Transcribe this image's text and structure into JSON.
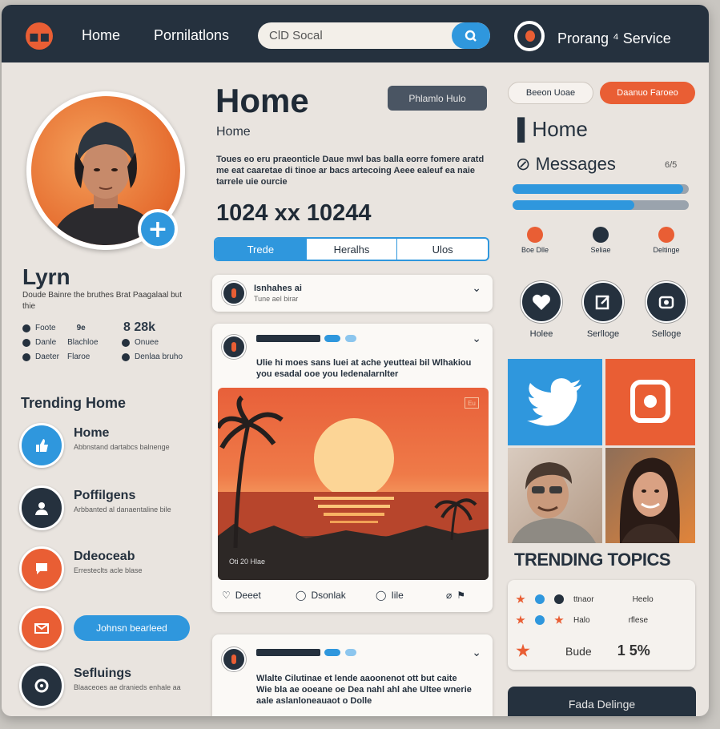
{
  "topbar": {
    "nav": [
      "Home",
      "Pornilatlons"
    ],
    "search_value": "ClD Socal",
    "brand": "Prorang ⁴ Service"
  },
  "profile": {
    "name": "Lyrn",
    "bio": "Doude Bainre the bruthes Brat Paagalaal but thie",
    "stats": [
      {
        "label": "Foote",
        "value": "9e"
      },
      {
        "label": "8 28k",
        "value": ""
      },
      {
        "label": "Danle",
        "value": "Blachloe"
      },
      {
        "label": "Onuee",
        "value": ""
      },
      {
        "label": "Daeter",
        "value": "Flaroe"
      },
      {
        "label": "Denlaa bruho",
        "value": ""
      }
    ]
  },
  "trending": {
    "title": "Trending Home",
    "items": [
      {
        "title": "Home",
        "desc": "Abbnstand dartabcs balnenge"
      },
      {
        "title": "Poffilgens",
        "desc": "Arbbanted al danaentaline bile"
      },
      {
        "title": "Ddeoceab",
        "desc": "Erresteclts acle blase"
      },
      {
        "title": "",
        "desc": ""
      },
      {
        "title": "Sefluings",
        "desc": "Blaaceoes ae dranieds enhale aa"
      }
    ],
    "pill_label": "Johnsn bearleed"
  },
  "main": {
    "title": "Home",
    "subtitle": "Home",
    "title_button": "Phlamlo Hulo",
    "description": "Toues eo eru praeonticle Daue mwl bas balla eorre fomere aratd me eat caaretae di tinoe ar bacs artecoing Aeee ealeuf ea naie tarrele uie ourcie",
    "dimension": "1024 xx 10244",
    "tabs": [
      "Trede",
      "Heralhs",
      "Ulos"
    ]
  },
  "posts": [
    {
      "name": "Isnhahes ai",
      "meta": "Tune ael birar"
    },
    {
      "text": "Ulie hi moes sans luei at ache yeutteai bil Wlhakiou you esadal ooe you ledenalarnlter",
      "image_caption": "Oti 20 Hlae",
      "image_badge": "Eu",
      "actions": [
        "Deeet",
        "Dsonlak",
        "Iile"
      ]
    },
    {
      "text": "Wlalte Cilutinae et lende aaoonenot ott but caite Wie bla ae ooeane oe Dea nahl ahl ahe Ultee wnerie aale aslanloneauaot o Dolle"
    }
  ],
  "right": {
    "buttons": [
      "Beeon Uoae",
      "Daanuo Faroeo"
    ],
    "heading_home": "Home",
    "heading_messages": "Messages",
    "messages_count": "6/5",
    "progress": [
      0.97,
      0.69
    ],
    "mini_icons": [
      "Boe Dlle",
      "Seliae",
      "Deltinge"
    ],
    "round_icons": [
      "Holee",
      "Serlloge",
      "Selloge"
    ],
    "trending_title": "TRENDING TOPICS",
    "trend_rows": [
      [
        "ttnaor",
        "Heelo"
      ],
      [
        "Halo",
        "rflese"
      ],
      [
        "Bude",
        "1 5%"
      ]
    ],
    "footer_button": "Fada Delinge"
  },
  "colors": {
    "accent": "#2f97dd",
    "orange": "#e95e34",
    "navy": "#25313e"
  }
}
